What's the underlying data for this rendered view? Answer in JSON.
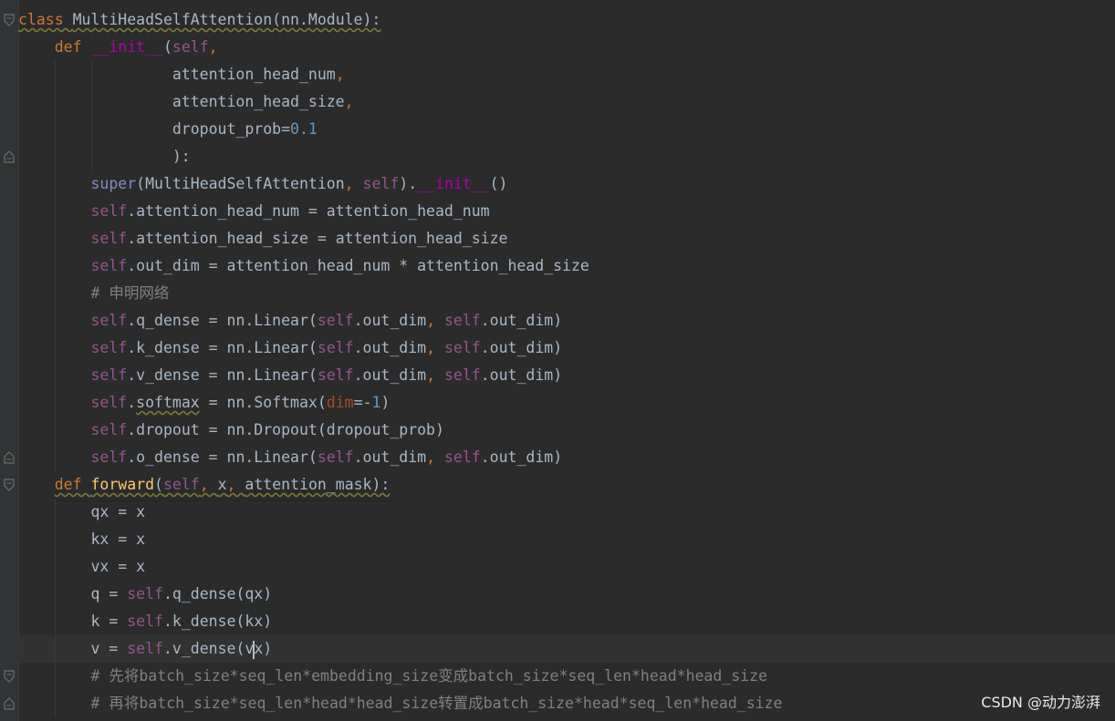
{
  "editor": {
    "lines": [
      [
        {
          "t": "class ",
          "c": "kw warn"
        },
        {
          "t": "MultiHeadSelfAttention(nn.Module):",
          "c": "warn"
        }
      ],
      [
        {
          "t": "    "
        },
        {
          "t": "def ",
          "c": "kw"
        },
        {
          "t": "__init__",
          "c": "magic"
        },
        {
          "t": "("
        },
        {
          "t": "self",
          "c": "self"
        },
        {
          "t": ",",
          "c": "kw"
        }
      ],
      [
        {
          "t": "                 attention_head_num"
        },
        {
          "t": ",",
          "c": "kw"
        }
      ],
      [
        {
          "t": "                 attention_head_size"
        },
        {
          "t": ",",
          "c": "kw"
        }
      ],
      [
        {
          "t": "                 dropout_prob="
        },
        {
          "t": "0.1",
          "c": "num"
        }
      ],
      [
        {
          "t": "                 ):"
        }
      ],
      [
        {
          "t": "        "
        },
        {
          "t": "super",
          "c": "bi"
        },
        {
          "t": "(MultiHeadSelfAttention"
        },
        {
          "t": ", ",
          "c": "kw"
        },
        {
          "t": "self",
          "c": "self"
        },
        {
          "t": ")."
        },
        {
          "t": "__init__",
          "c": "magic"
        },
        {
          "t": "()"
        }
      ],
      [
        {
          "t": "        "
        },
        {
          "t": "self",
          "c": "self"
        },
        {
          "t": ".attention_head_num = attention_head_num"
        }
      ],
      [
        {
          "t": "        "
        },
        {
          "t": "self",
          "c": "self"
        },
        {
          "t": ".attention_head_size = attention_head_size"
        }
      ],
      [
        {
          "t": "        "
        },
        {
          "t": "self",
          "c": "self"
        },
        {
          "t": ".out_dim = attention_head_num * attention_head_size"
        }
      ],
      [
        {
          "t": "        # 申明网络",
          "c": "cmt"
        }
      ],
      [
        {
          "t": "        "
        },
        {
          "t": "self",
          "c": "self"
        },
        {
          "t": ".q_dense = nn.Linear("
        },
        {
          "t": "self",
          "c": "self"
        },
        {
          "t": ".out_dim"
        },
        {
          "t": ", ",
          "c": "kw"
        },
        {
          "t": "self",
          "c": "self"
        },
        {
          "t": ".out_dim)"
        }
      ],
      [
        {
          "t": "        "
        },
        {
          "t": "self",
          "c": "self"
        },
        {
          "t": ".k_dense = nn.Linear("
        },
        {
          "t": "self",
          "c": "self"
        },
        {
          "t": ".out_dim"
        },
        {
          "t": ", ",
          "c": "kw"
        },
        {
          "t": "self",
          "c": "self"
        },
        {
          "t": ".out_dim)"
        }
      ],
      [
        {
          "t": "        "
        },
        {
          "t": "self",
          "c": "self"
        },
        {
          "t": ".v_dense = nn.Linear("
        },
        {
          "t": "self",
          "c": "self"
        },
        {
          "t": ".out_dim"
        },
        {
          "t": ", ",
          "c": "kw"
        },
        {
          "t": "self",
          "c": "self"
        },
        {
          "t": ".out_dim)"
        }
      ],
      [
        {
          "t": "        "
        },
        {
          "t": "self",
          "c": "self"
        },
        {
          "t": "."
        },
        {
          "t": "softmax",
          "c": "warn"
        },
        {
          "t": " = nn.Softmax("
        },
        {
          "t": "dim",
          "c": "param"
        },
        {
          "t": "=-"
        },
        {
          "t": "1",
          "c": "num"
        },
        {
          "t": ")"
        }
      ],
      [
        {
          "t": "        "
        },
        {
          "t": "self",
          "c": "self"
        },
        {
          "t": ".dropout = nn.Dropout(dropout_prob)"
        }
      ],
      [
        {
          "t": "        "
        },
        {
          "t": "self",
          "c": "self"
        },
        {
          "t": ".o_dense = nn.Linear("
        },
        {
          "t": "self",
          "c": "self"
        },
        {
          "t": ".out_dim"
        },
        {
          "t": ", ",
          "c": "kw"
        },
        {
          "t": "self",
          "c": "self"
        },
        {
          "t": ".out_dim)"
        }
      ],
      [
        {
          "t": "    "
        },
        {
          "t": "def ",
          "c": "kw warn"
        },
        {
          "t": "forward",
          "c": "fn warn"
        },
        {
          "t": "(",
          "c": "warn"
        },
        {
          "t": "self",
          "c": "self warn"
        },
        {
          "t": ", ",
          "c": "kw warn"
        },
        {
          "t": "x",
          "c": "warn"
        },
        {
          "t": ", ",
          "c": "kw warn"
        },
        {
          "t": "attention_mask):",
          "c": "warn"
        }
      ],
      [
        {
          "t": "        qx = x"
        }
      ],
      [
        {
          "t": "        kx = x"
        }
      ],
      [
        {
          "t": "        vx = x"
        }
      ],
      [
        {
          "t": "        q = "
        },
        {
          "t": "self",
          "c": "self"
        },
        {
          "t": ".q_dense(qx)"
        }
      ],
      [
        {
          "t": "        k = "
        },
        {
          "t": "self",
          "c": "self"
        },
        {
          "t": ".k_dense(kx)"
        }
      ],
      [
        {
          "t": "        v = "
        },
        {
          "t": "self",
          "c": "self"
        },
        {
          "t": ".v_dense(v"
        },
        {
          "caret": true
        },
        {
          "t": "x)"
        }
      ],
      [
        {
          "t": "        # 先将batch_size*seq_len*embedding_size变成batch_size*seq_len*head*head_size",
          "c": "cmt"
        }
      ],
      [
        {
          "t": "        # 再将batch_size*seq_len*head*head_size转置成batch_size*head*seq_len*head_size",
          "c": "cmt"
        }
      ]
    ],
    "current_line_index": 23,
    "folds": [
      {
        "line": 0,
        "kind": "open"
      },
      {
        "line": 5,
        "kind": "close"
      },
      {
        "line": 16,
        "kind": "close"
      },
      {
        "line": 17,
        "kind": "open"
      },
      {
        "line": 24,
        "kind": "open"
      },
      {
        "line": 25,
        "kind": "close"
      }
    ]
  },
  "watermark": "CSDN @动力澎湃"
}
